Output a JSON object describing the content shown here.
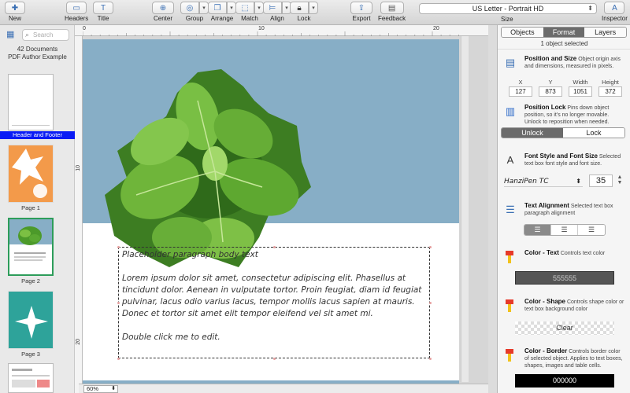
{
  "toolbar": {
    "new": "New",
    "headers": "Headers",
    "title": "Title",
    "center": "Center",
    "group": "Group",
    "arrange": "Arrange",
    "match": "Match",
    "align": "Align",
    "lock": "Lock",
    "export": "Export",
    "feedback": "Feedback",
    "page_size": "US Letter - Portrait HD",
    "size": "Size",
    "inspector": "Inspector"
  },
  "sidebar": {
    "search_placeholder": "Search",
    "doc_count": "42 Documents",
    "doc_name": "PDF Author Example",
    "pages": [
      {
        "label": "Header and Footer"
      },
      {
        "label": "Page 1"
      },
      {
        "label": "Page 2"
      },
      {
        "label": "Page 3"
      }
    ]
  },
  "rulers": {
    "h": [
      "0",
      "10",
      "20"
    ],
    "v": [
      "10",
      "20"
    ]
  },
  "canvas": {
    "zoom": "60%",
    "text_title": "Placeholder paragraph body text",
    "text_body": "Lorem ipsum dolor sit amet, consectetur adipiscing elit. Phasellus at tincidunt dolor. Aenean in vulputate tortor. Proin feugiat, diam id feugiat pulvinar, lacus odio varius lacus, tempor mollis lacus sapien at mauris. Donec et tortor sit amet elit tempor eleifend vel sit amet mi.",
    "text_hint": "Double click me to edit."
  },
  "inspector": {
    "tabs": [
      "Objects",
      "Format",
      "Layers"
    ],
    "active_tab": "Format",
    "selection": "1 object selected",
    "position": {
      "title": "Position and Size",
      "desc": "Object origin axis and dimensions, measured in pixels.",
      "labels": [
        "X",
        "Y",
        "Width",
        "Height"
      ],
      "values": [
        "127",
        "873",
        "1051",
        "372"
      ]
    },
    "lock": {
      "title": "Position Lock",
      "desc": "Pins down object position, so it's no longer movable.  Unlock to reposition when needed.",
      "unlock": "Unlock",
      "lock": "Lock"
    },
    "font": {
      "title": "Font Style and Font Size",
      "desc": "Selected text box font style and font size.",
      "family": "HanziPen TC",
      "size": "35"
    },
    "align": {
      "title": "Text Alignment",
      "desc": "Selected text box paragraph alignment"
    },
    "color_text": {
      "title": "Color - Text",
      "desc": "Controls text color",
      "value": "555555",
      "hex": "#555555"
    },
    "color_shape": {
      "title": "Color - Shape",
      "desc": "Controls shape color or text box background color",
      "value": "Clear"
    },
    "color_border": {
      "title": "Color - Border",
      "desc": "Controls border color of selected object.  Applies to text boxes, shapes, images and table cells.",
      "value": "000000",
      "hex": "#000000"
    }
  },
  "colors": {
    "accent": "#3a6fb4",
    "selected_page": "#0a1cf5",
    "banner": "#87aec6",
    "thumb_orange": "#f39a4a",
    "thumb_teal": "#2ea39a"
  }
}
